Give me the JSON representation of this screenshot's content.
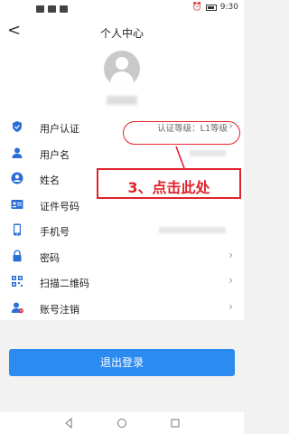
{
  "status": {
    "time": "9:30"
  },
  "nav": {
    "back": "<",
    "title": "个人中心"
  },
  "items": [
    {
      "label": "用户认证",
      "value": "认证等级：L1等级"
    },
    {
      "label": "用户名",
      "value": ""
    },
    {
      "label": "姓名",
      "value": ""
    },
    {
      "label": "证件号码",
      "value": ""
    },
    {
      "label": "手机号",
      "value": ""
    },
    {
      "label": "密码",
      "value": ""
    },
    {
      "label": "扫描二维码",
      "value": ""
    },
    {
      "label": "账号注销",
      "value": ""
    }
  ],
  "annotation": {
    "text": "3、点击此处"
  },
  "logout_label": "退出登录",
  "colors": {
    "accent": "#2b8bf0",
    "annotation": "#e0232b"
  }
}
